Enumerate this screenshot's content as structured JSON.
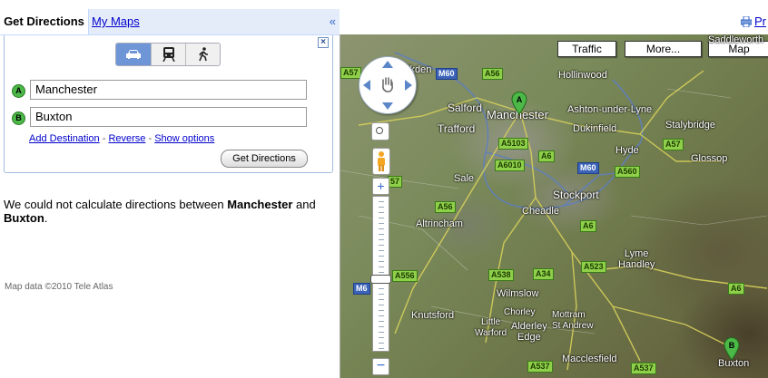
{
  "tabs": {
    "directions": "Get Directions",
    "my_maps": "My Maps",
    "collapse": "«"
  },
  "form": {
    "close": "×",
    "modes": [
      "car-icon",
      "transit-icon",
      "walk-icon"
    ],
    "selected_mode": "car",
    "waypoint_a": {
      "marker": "A",
      "value": "Manchester"
    },
    "waypoint_b": {
      "marker": "B",
      "value": "Buxton"
    },
    "links": {
      "add_destination": "Add Destination",
      "sep1": " - ",
      "reverse": "Reverse",
      "sep2": " - ",
      "show_options": "Show options"
    },
    "submit_label": "Get Directions"
  },
  "message": {
    "prefix": "We could not calculate directions between ",
    "from": "Manchester",
    "middle": " and ",
    "to": "Buxton",
    "suffix": "."
  },
  "map_data_credit": "Map data ©2010 Tele Atlas",
  "top": {
    "print_label": "Pr"
  },
  "map": {
    "buttons": {
      "traffic": "Traffic",
      "more": "More...",
      "map": "Map"
    },
    "places": {
      "manchester": "Manchester",
      "salford": "Salford",
      "trafford": "Trafford",
      "hollinwood": "Hollinwood",
      "ashton": "Ashton-under-Lyne",
      "stalybridge": "Stalybridge",
      "dukinfield": "Dukinfield",
      "hyde": "Hyde",
      "glossop": "Glossop",
      "sale": "Sale",
      "stockport": "Stockport",
      "cheadle": "Cheadle",
      "altrincham": "Altrincham",
      "wilmslow": "Wilmslow",
      "knutsford": "Knutsford",
      "chorley": "Chorley",
      "alderley": "Alderley\nEdge",
      "little_warford": "Little\nWarford",
      "mottram": "Mottram\nSt Andrew",
      "lyme": "Lyme\nHandley",
      "macclesfield": "Macclesfield",
      "buxton": "Buxton",
      "saddleworth": "Saddleworth",
      "walkden": "alkden"
    },
    "shields": {
      "m60_n": "M60",
      "a56_n": "A56",
      "a57_w": "A57",
      "a5103": "A5103",
      "a6_c": "A6",
      "a6010": "A6010",
      "a57_e": "A57",
      "a560": "A560",
      "m60_e": "M60",
      "a56_s": "A56",
      "a6_s": "A6",
      "a523": "A523",
      "a556": "A556",
      "a538": "A538",
      "a34": "A34",
      "m6": "M6",
      "a537_w": "A537",
      "a537_e": "A537",
      "a6_e": "A6",
      "a57_nw": "57"
    },
    "pins": {
      "a": "A",
      "b": "B"
    }
  }
}
